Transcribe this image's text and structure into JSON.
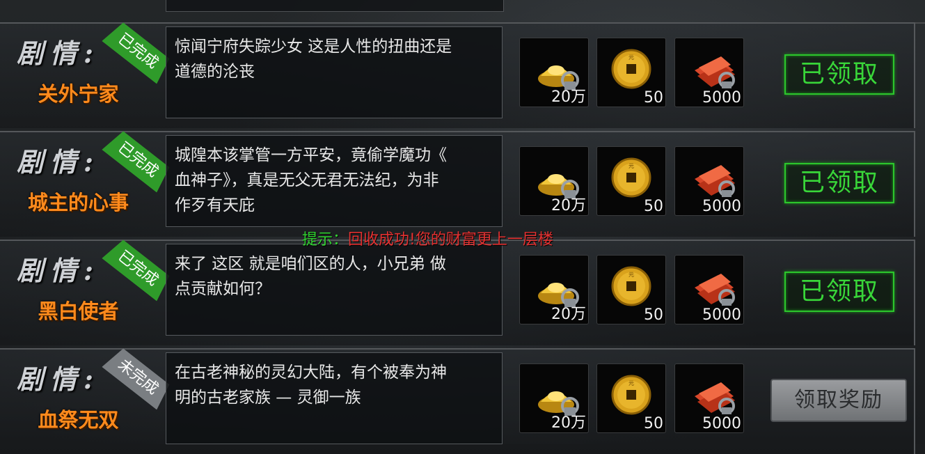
{
  "hint": {
    "label": "提示：",
    "text": "回收成功!您的财富更上一层楼"
  },
  "story_label": "剧情:",
  "colors": {
    "done": "#2f9b2a",
    "pending": "#7a7e82",
    "name": "#ff8a1c",
    "claimed": "#39d639",
    "hint_label": "#31d331",
    "hint_text": "#e23131"
  },
  "rewards": [
    {
      "icon": "gold-ingot-icon",
      "qty": "20万"
    },
    {
      "icon": "copper-coin-icon",
      "qty": "50"
    },
    {
      "icon": "red-bundle-icon",
      "qty": "5000"
    }
  ],
  "quests": [
    {
      "name": "关外宁家",
      "status": "已完成",
      "desc_lines": [
        "惊闻宁府失踪少女 这是人性的扭曲还是",
        "道德的沦丧"
      ],
      "button": "已领取",
      "claimed": true
    },
    {
      "name": "城主的心事",
      "status": "已完成",
      "desc_lines": [
        "城隍本该掌管一方平安，竟偷学魔功《",
        "血神子》，真是无父无君无法纪，为非",
        "作歹有天庇"
      ],
      "button": "已领取",
      "claimed": true
    },
    {
      "name": "黑白使者",
      "status": "已完成",
      "desc_lines": [
        "来了 这区 就是咱们区的人，小兄弟 做",
        "点贡献如何？"
      ],
      "button": "已领取",
      "claimed": true
    },
    {
      "name": "血祭无双",
      "status": "未完成",
      "desc_lines": [
        "在古老神秘的灵幻大陆，有个被奉为神",
        "明的古老家族 — 灵御一族"
      ],
      "button": "领取奖励",
      "claimed": false
    }
  ]
}
